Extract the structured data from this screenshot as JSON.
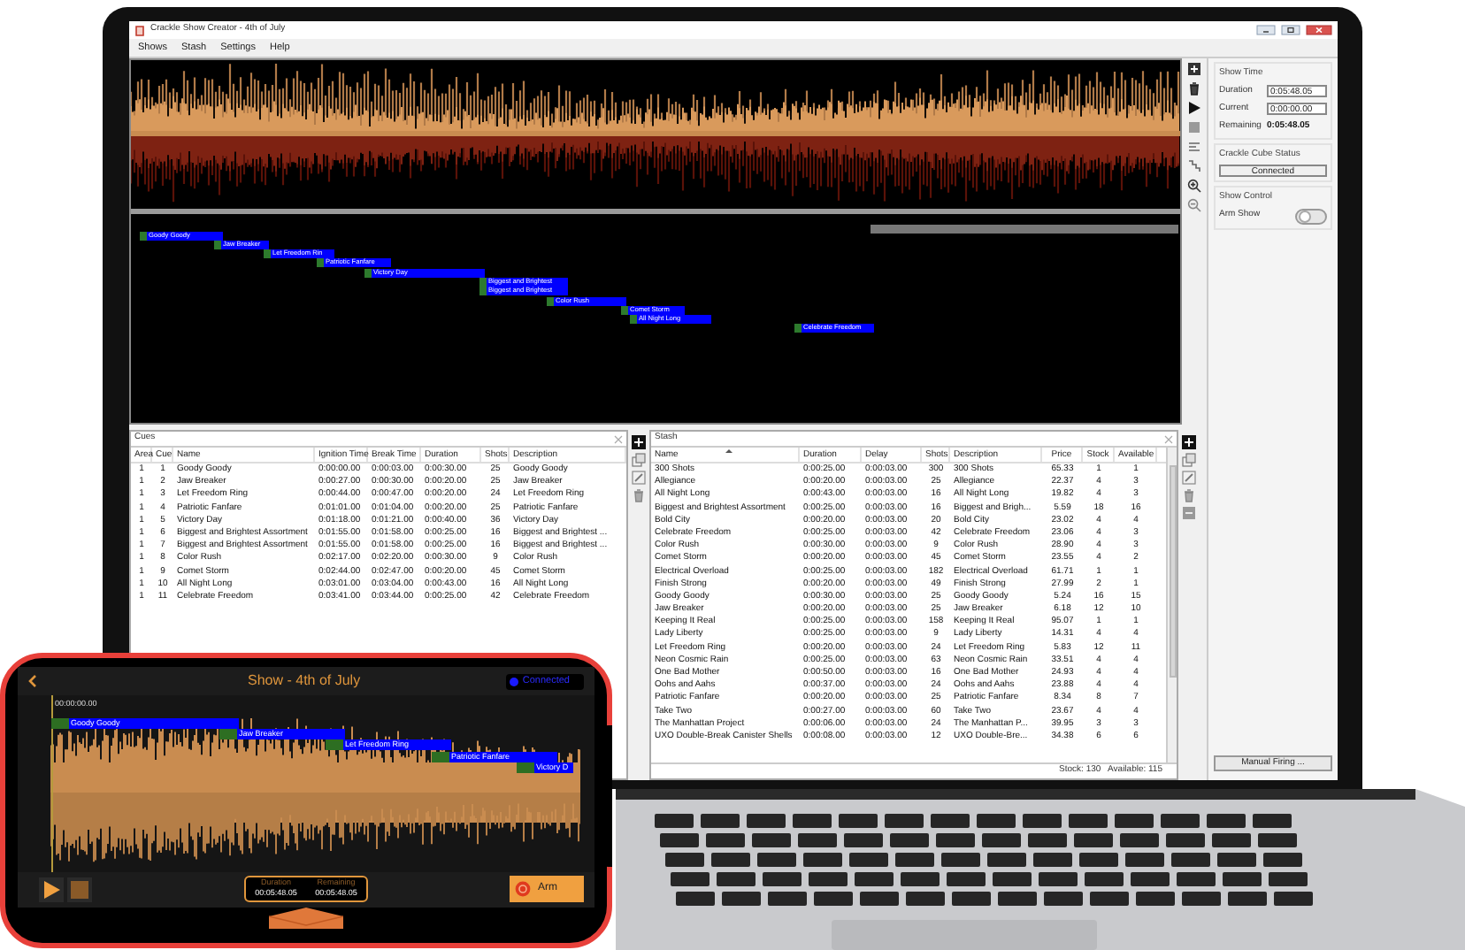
{
  "window": {
    "title": "Crackle Show Creator - 4th of July"
  },
  "menu": [
    "Shows",
    "Stash",
    "Settings",
    "Help"
  ],
  "timeline": {
    "cues": [
      {
        "label": "Goody Goody"
      },
      {
        "label": "Jaw Breaker"
      },
      {
        "label": "Let Freedom Rin"
      },
      {
        "label": "Patriotic Fanfare"
      },
      {
        "label": "Victory Day"
      },
      {
        "label": "Biggest and Brightest"
      },
      {
        "label": "Biggest and Brightest"
      },
      {
        "label": "Color Rush"
      },
      {
        "label": "Comet Storm"
      },
      {
        "label": "All Night Long"
      },
      {
        "label": "Celebrate Freedom"
      }
    ]
  },
  "show_time": {
    "title": "Show Time",
    "fields": [
      {
        "label": "Duration",
        "value": "0:05:48.05",
        "kind": "field"
      },
      {
        "label": "Current",
        "value": "0:00:00.00",
        "kind": "field"
      },
      {
        "label": "Remaining",
        "value": "0:05:48.05",
        "kind": "text"
      }
    ]
  },
  "cube_status": {
    "title": "Crackle Cube Status",
    "value": "Connected"
  },
  "show_control": {
    "title": "Show Control",
    "label": "Arm Show",
    "on": false
  },
  "manual_firing_button": "Manual Firing ...",
  "cues": {
    "title": "Cues",
    "columns": [
      "Area",
      "Cue",
      "Name",
      "Ignition Time",
      "Break Time",
      "Duration",
      "Shots",
      "Description"
    ],
    "rows": [
      [
        "1",
        "1",
        "Goody Goody",
        "0:00:00.00",
        "0:00:03.00",
        "0:00:30.00",
        "25",
        "Goody Goody"
      ],
      [
        "1",
        "2",
        "Jaw Breaker",
        "0:00:27.00",
        "0:00:30.00",
        "0:00:20.00",
        "25",
        "Jaw Breaker"
      ],
      [
        "1",
        "3",
        "Let Freedom Ring",
        "0:00:44.00",
        "0:00:47.00",
        "0:00:20.00",
        "24",
        "Let Freedom Ring"
      ],
      [
        "1",
        "4",
        "Patriotic Fanfare",
        "0:01:01.00",
        "0:01:04.00",
        "0:00:20.00",
        "25",
        "Patriotic Fanfare"
      ],
      [
        "1",
        "5",
        "Victory Day",
        "0:01:18.00",
        "0:01:21.00",
        "0:00:40.00",
        "36",
        "Victory Day"
      ],
      [
        "1",
        "6",
        "Biggest and Brightest Assortment",
        "0:01:55.00",
        "0:01:58.00",
        "0:00:25.00",
        "16",
        "Biggest and Brightest ..."
      ],
      [
        "1",
        "7",
        "Biggest and Brightest Assortment",
        "0:01:55.00",
        "0:01:58.00",
        "0:00:25.00",
        "16",
        "Biggest and Brightest ..."
      ],
      [
        "1",
        "8",
        "Color Rush",
        "0:02:17.00",
        "0:02:20.00",
        "0:00:30.00",
        "9",
        "Color Rush"
      ],
      [
        "1",
        "9",
        "Comet Storm",
        "0:02:44.00",
        "0:02:47.00",
        "0:00:20.00",
        "45",
        "Comet Storm"
      ],
      [
        "1",
        "10",
        "All Night Long",
        "0:03:01.00",
        "0:03:04.00",
        "0:00:43.00",
        "16",
        "All Night Long"
      ],
      [
        "1",
        "11",
        "Celebrate Freedom",
        "0:03:41.00",
        "0:03:44.00",
        "0:00:25.00",
        "42",
        "Celebrate Freedom"
      ]
    ]
  },
  "stash": {
    "title": "Stash",
    "columns": [
      {
        "label": "Name",
        "sorted": true
      },
      {
        "label": "Duration",
        "sorted": false
      },
      {
        "label": "Delay",
        "sorted": false
      },
      {
        "label": "Shots",
        "sorted": false
      },
      {
        "label": "Description",
        "sorted": false
      },
      {
        "label": "Price",
        "sorted": false
      },
      {
        "label": "Stock",
        "sorted": false
      },
      {
        "label": "Available",
        "sorted": false
      }
    ],
    "rows": [
      [
        "300 Shots",
        "0:00:25.00",
        "0:00:03.00",
        "300",
        "300 Shots",
        "65.33",
        "1",
        "1"
      ],
      [
        "Allegiance",
        "0:00:20.00",
        "0:00:03.00",
        "25",
        "Allegiance",
        "22.37",
        "4",
        "3"
      ],
      [
        "All Night Long",
        "0:00:43.00",
        "0:00:03.00",
        "16",
        "All Night Long",
        "19.82",
        "4",
        "3"
      ],
      [
        "Biggest and Brightest Assortment",
        "0:00:25.00",
        "0:00:03.00",
        "16",
        "Biggest and Brigh...",
        "5.59",
        "18",
        "16"
      ],
      [
        "Bold City",
        "0:00:20.00",
        "0:00:03.00",
        "20",
        "Bold City",
        "23.02",
        "4",
        "4"
      ],
      [
        "Celebrate Freedom",
        "0:00:25.00",
        "0:00:03.00",
        "42",
        "Celebrate Freedom",
        "23.06",
        "4",
        "3"
      ],
      [
        "Color Rush",
        "0:00:30.00",
        "0:00:03.00",
        "9",
        "Color Rush",
        "28.90",
        "4",
        "3"
      ],
      [
        "Comet Storm",
        "0:00:20.00",
        "0:00:03.00",
        "45",
        "Comet Storm",
        "23.55",
        "4",
        "2"
      ],
      [
        "Electrical Overload",
        "0:00:25.00",
        "0:00:03.00",
        "182",
        "Electrical Overload",
        "61.71",
        "1",
        "1"
      ],
      [
        "Finish Strong",
        "0:00:20.00",
        "0:00:03.00",
        "49",
        "Finish Strong",
        "27.99",
        "2",
        "1"
      ],
      [
        "Goody Goody",
        "0:00:30.00",
        "0:00:03.00",
        "25",
        "Goody Goody",
        "5.24",
        "16",
        "15"
      ],
      [
        "Jaw Breaker",
        "0:00:20.00",
        "0:00:03.00",
        "25",
        "Jaw Breaker",
        "6.18",
        "12",
        "10"
      ],
      [
        "Keeping It Real",
        "0:00:25.00",
        "0:00:03.00",
        "158",
        "Keeping It Real",
        "95.07",
        "1",
        "1"
      ],
      [
        "Lady Liberty",
        "0:00:25.00",
        "0:00:03.00",
        "9",
        "Lady Liberty",
        "14.31",
        "4",
        "4"
      ],
      [
        "Let Freedom Ring",
        "0:00:20.00",
        "0:00:03.00",
        "24",
        "Let Freedom Ring",
        "5.83",
        "12",
        "11"
      ],
      [
        "Neon Cosmic Rain",
        "0:00:25.00",
        "0:00:03.00",
        "63",
        "Neon Cosmic Rain",
        "33.51",
        "4",
        "4"
      ],
      [
        "One Bad Mother",
        "0:00:50.00",
        "0:00:03.00",
        "16",
        "One Bad Mother",
        "24.93",
        "4",
        "4"
      ],
      [
        "Oohs and Aahs",
        "0:00:37.00",
        "0:00:03.00",
        "24",
        "Oohs and Aahs",
        "23.88",
        "4",
        "4"
      ],
      [
        "Patriotic Fanfare",
        "0:00:20.00",
        "0:00:03.00",
        "25",
        "Patriotic Fanfare",
        "8.34",
        "8",
        "7"
      ],
      [
        "Take Two",
        "0:00:27.00",
        "0:00:03.00",
        "60",
        "Take Two",
        "23.67",
        "4",
        "4"
      ],
      [
        "The Manhattan Project",
        "0:00:06.00",
        "0:00:03.00",
        "24",
        "The Manhattan P...",
        "39.95",
        "3",
        "3"
      ],
      [
        "UXO Double-Break Canister Shells",
        "0:00:08.00",
        "0:00:03.00",
        "12",
        "UXO Double-Bre...",
        "34.38",
        "6",
        "6"
      ]
    ],
    "status": "Stock: 130   Available: 115"
  },
  "phone": {
    "title": "Show - 4th of July",
    "status": "Connected",
    "time": "00:00:00.00",
    "cues": [
      {
        "label": "Goody Goody"
      },
      {
        "label": "Jaw Breaker"
      },
      {
        "label": "Let Freedom Ring"
      },
      {
        "label": "Patriotic Fanfare"
      },
      {
        "label": "Victory D"
      }
    ],
    "stats": [
      {
        "label": "Duration",
        "value": "00:05:48.05"
      },
      {
        "label": "Remaining",
        "value": "00:05:48.05"
      }
    ],
    "arm_button": "Arm"
  }
}
